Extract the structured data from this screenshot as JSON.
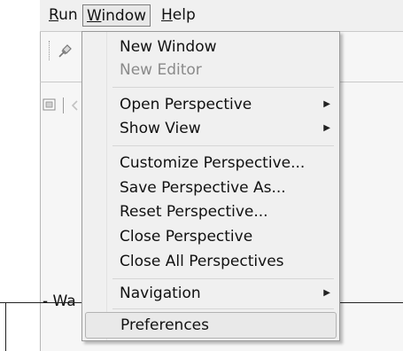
{
  "menubar": {
    "run": {
      "label": "Run",
      "mnemonic": "R",
      "rest": "un"
    },
    "window": {
      "label": "Window",
      "mnemonic": "W",
      "rest": "indow"
    },
    "help": {
      "label": "Help",
      "mnemonic": "H",
      "rest": "elp"
    }
  },
  "editor": {
    "title_fragment": "- Wa"
  },
  "window_menu": {
    "items": [
      {
        "label": "New Window",
        "enabled": true
      },
      {
        "label": "New Editor",
        "enabled": false
      },
      {
        "label": "Open Perspective",
        "enabled": true,
        "submenu": true
      },
      {
        "label": "Show View",
        "enabled": true,
        "submenu": true
      },
      {
        "label": "Customize Perspective...",
        "enabled": true
      },
      {
        "label": "Save Perspective As...",
        "enabled": true
      },
      {
        "label": "Reset Perspective...",
        "enabled": true
      },
      {
        "label": "Close Perspective",
        "enabled": true
      },
      {
        "label": "Close All Perspectives",
        "enabled": true
      },
      {
        "label": "Navigation",
        "enabled": true,
        "submenu": true
      },
      {
        "label": "Preferences",
        "enabled": true,
        "highlighted": true
      }
    ],
    "submenu_arrow": "▶"
  }
}
